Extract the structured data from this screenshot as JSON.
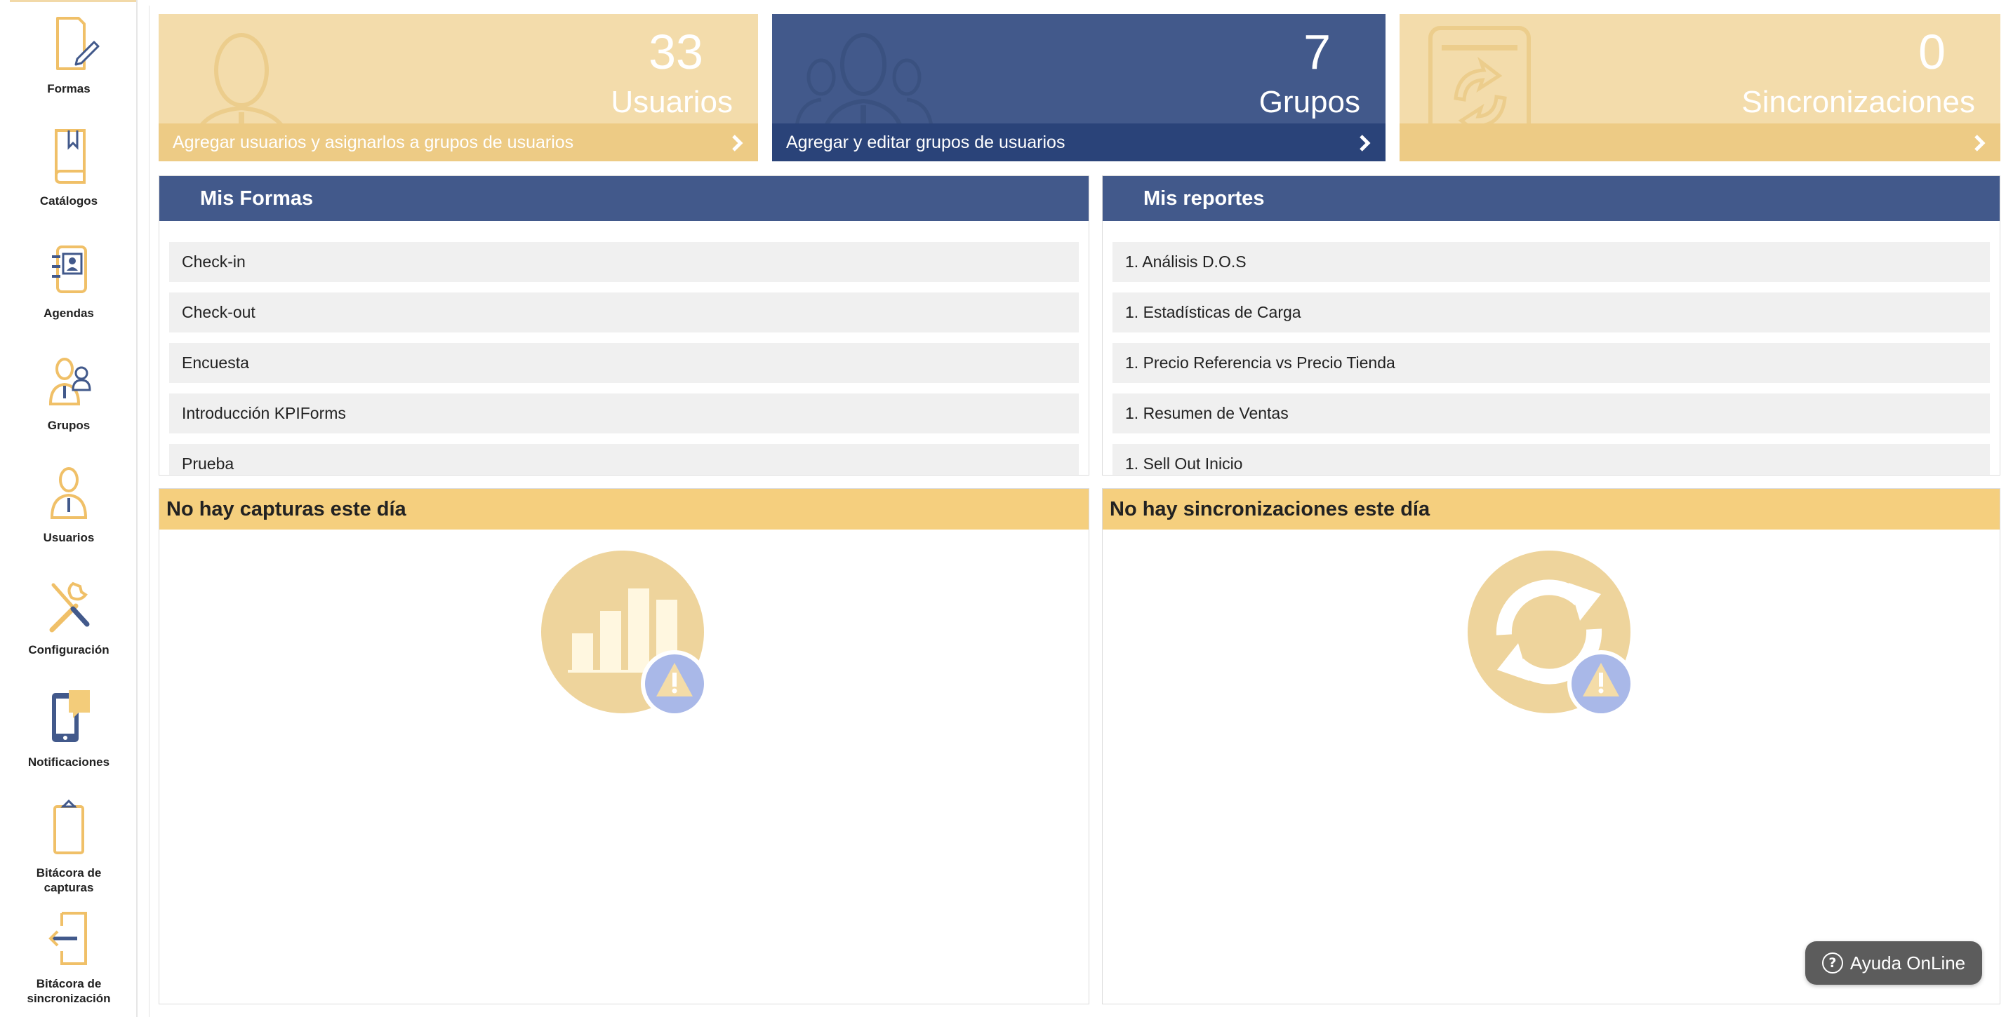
{
  "sidebar": {
    "items": [
      {
        "label": "Formas",
        "icon": "form-pencil-icon"
      },
      {
        "label": "Catálogos",
        "icon": "catalog-book-icon"
      },
      {
        "label": "Agendas",
        "icon": "agenda-contact-icon"
      },
      {
        "label": "Grupos",
        "icon": "groups-icon"
      },
      {
        "label": "Usuarios",
        "icon": "user-icon"
      },
      {
        "label": "Configuración",
        "icon": "wrench-screwdriver-icon"
      },
      {
        "label": "Notificaciones",
        "icon": "tablet-message-icon"
      },
      {
        "label": "Bitácora de\ncapturas",
        "icon": "clipboard-icon"
      },
      {
        "label": "Bitácora de\nsincronización",
        "icon": "sync-exit-icon"
      }
    ]
  },
  "tiles": {
    "users": {
      "number": "33",
      "label": "Usuarios",
      "footer": "Agregar usuarios y asignarlos a grupos de usuarios"
    },
    "groups": {
      "number": "7",
      "label": "Grupos",
      "footer": "Agregar y editar grupos de usuarios"
    },
    "syncs": {
      "number": "0",
      "label": "Sincronizaciones",
      "footer": ""
    }
  },
  "forms_panel": {
    "title": "Mis Formas",
    "items": [
      "Check-in",
      "Check-out",
      "Encuesta",
      "Introducción KPIForms",
      "Prueba"
    ]
  },
  "reports_panel": {
    "title": "Mis reportes",
    "items": [
      "1. Análisis D.O.S",
      "1. Estadísticas de Carga",
      "1. Precio Referencia vs Precio Tienda",
      "1. Resumen de Ventas",
      "1. Sell Out Inicio"
    ]
  },
  "captures_panel": {
    "title": "No hay capturas este día",
    "icon": "bar-chart-warning-icon"
  },
  "syncs_panel": {
    "title": "No hay sincronizaciones este día",
    "icon": "sync-warning-icon"
  },
  "help": {
    "label": "Ayuda OnLine",
    "icon": "question-icon"
  },
  "colors": {
    "navy": "#42598b",
    "navy_dark": "#2a4379",
    "gold": "#f3dcab",
    "gold_dark": "#edcb85",
    "gold_header": "#f5cf7e"
  }
}
